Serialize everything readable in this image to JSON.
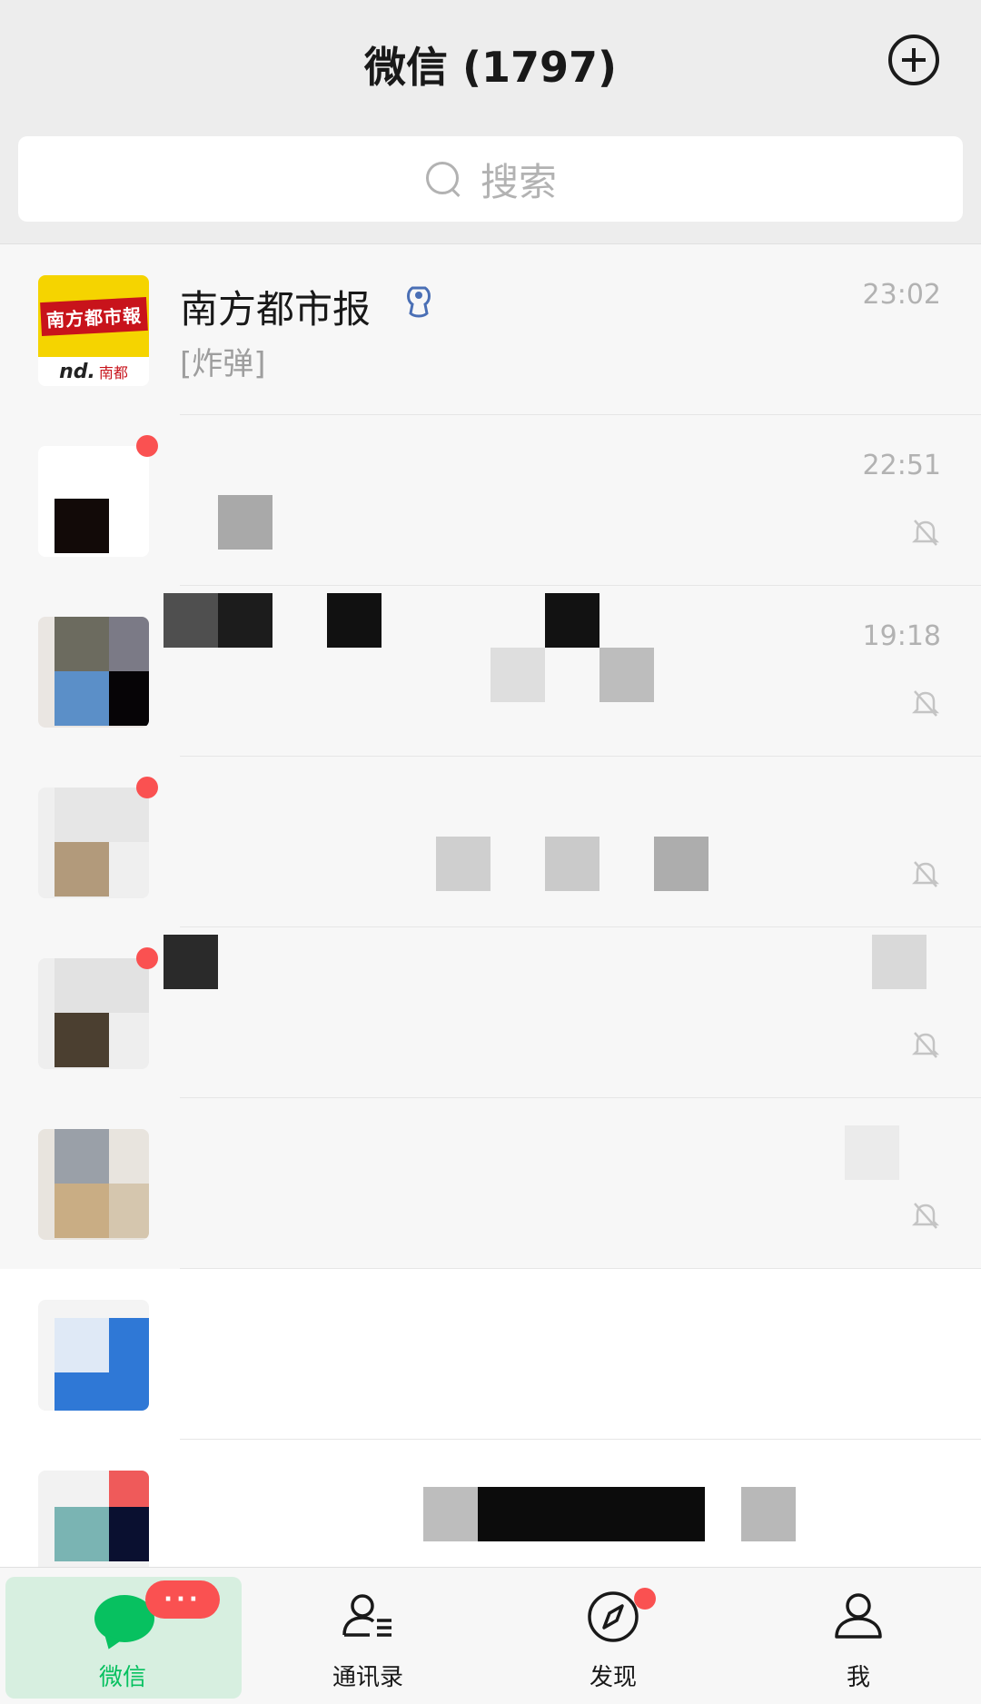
{
  "header": {
    "title": "微信 (1797)",
    "add_icon": "plus-circle-icon"
  },
  "search": {
    "placeholder": "搜索",
    "icon": "search-icon"
  },
  "chats": [
    {
      "name": "南方都市报",
      "preview": "[炸弹]",
      "time": "23:02",
      "avatar_text_top": "南方都市報",
      "avatar_text_logo": "nd.",
      "avatar_text_brand": "南都",
      "verified_icon": "official-account-icon"
    },
    {
      "name": "",
      "preview": "",
      "time": "22:51",
      "muted": true,
      "unread_dot": true
    },
    {
      "name": "",
      "preview": "",
      "time": "19:18",
      "muted": true
    },
    {
      "name": "",
      "preview": "",
      "time": "",
      "muted": true,
      "unread_dot": true
    },
    {
      "name": "",
      "preview": "",
      "time": "",
      "muted": true,
      "unread_dot": true
    },
    {
      "name": "",
      "preview": "",
      "time": "",
      "muted": true
    },
    {
      "name": "",
      "preview": "",
      "time": ""
    },
    {
      "name": "",
      "preview": "",
      "time": ""
    }
  ],
  "tabbar": {
    "tabs": [
      {
        "label": "微信",
        "icon": "chat-bubble-icon",
        "active": true
      },
      {
        "label": "通讯录",
        "icon": "contacts-icon",
        "active": false
      },
      {
        "label": "发现",
        "icon": "compass-icon",
        "active": false,
        "dot": true
      },
      {
        "label": "我",
        "icon": "person-icon",
        "active": false
      }
    ],
    "more_badge": "···"
  },
  "colors": {
    "accent": "#07c160",
    "badge": "#fa5151",
    "background": "#ededed"
  }
}
